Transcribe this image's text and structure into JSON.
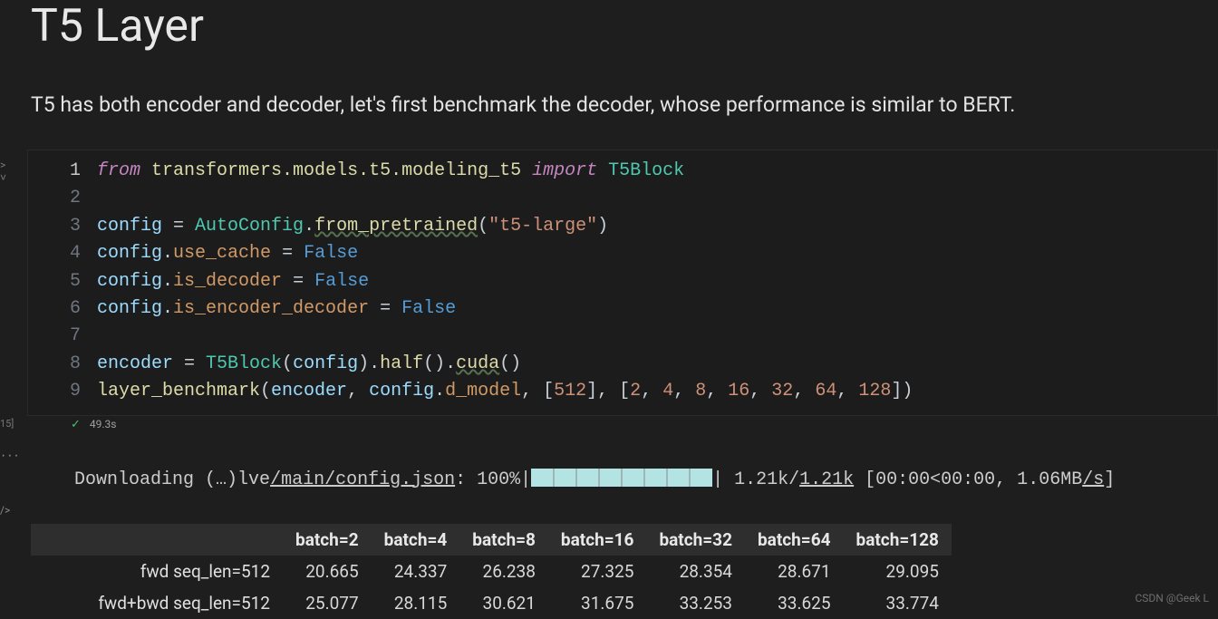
{
  "title": "T5 Layer",
  "lead": "T5 has both encoder and decoder, let's first benchmark the decoder, whose performance is similar to BERT.",
  "code_lines": [
    "1",
    "2",
    "3",
    "4",
    "5",
    "6",
    "7",
    "8",
    "9"
  ],
  "status": {
    "gutter_label": "15]",
    "check": "✓",
    "time": "49.3s"
  },
  "output": {
    "prefix": "Downloading (…)lve",
    "link1": "/main/config.json",
    "pct": ": 100%|",
    "right_a": "| 1.21k/",
    "link2": "1.21k",
    "right_b": " [00:00<00:00, 1.06MB",
    "link3": "/s",
    "right_c": "]"
  },
  "table": {
    "cols": [
      "batch=2",
      "batch=4",
      "batch=8",
      "batch=16",
      "batch=32",
      "batch=64",
      "batch=128"
    ],
    "rows": [
      {
        "label": "fwd seq_len=512",
        "vals": [
          "20.665",
          "24.337",
          "26.238",
          "27.325",
          "28.354",
          "28.671",
          "29.095"
        ]
      },
      {
        "label": "fwd+bwd seq_len=512",
        "vals": [
          "25.077",
          "28.115",
          "30.621",
          "31.675",
          "33.253",
          "33.625",
          "33.774"
        ]
      }
    ]
  },
  "chart_data": {
    "type": "table",
    "columns": [
      "",
      "batch=2",
      "batch=4",
      "batch=8",
      "batch=16",
      "batch=32",
      "batch=64",
      "batch=128"
    ],
    "rows": [
      [
        "fwd seq_len=512",
        20.665,
        24.337,
        26.238,
        27.325,
        28.354,
        28.671,
        29.095
      ],
      [
        "fwd+bwd seq_len=512",
        25.077,
        28.115,
        30.621,
        31.675,
        33.253,
        33.625,
        33.774
      ]
    ]
  },
  "watermark": "CSDN @Geek L",
  "gutter_top": {
    "a": ">",
    "b": "˅"
  },
  "gutter_dots": "···",
  "gutter_slash": "/>",
  "code": {
    "l1_from": "from",
    "l1_pkg": "transformers.models.t5.modeling_t5",
    "l1_import": "import",
    "l1_cls": "T5Block",
    "l3_cfg": "config",
    "l3_eq": " = ",
    "l3_auto": "AutoConfig",
    "l3_d": ".",
    "l3_fp": "from_pretrained",
    "l3_op": "(",
    "l3_str": "\"t5-large\"",
    "l3_cp": ")",
    "l4_cfg": "config",
    "l4_d": ".",
    "l4_prop": "use_cache",
    "l4_eq": " = ",
    "l4_val": "False",
    "l5_cfg": "config",
    "l5_d": ".",
    "l5_prop": "is_decoder",
    "l5_eq": " = ",
    "l5_val": "False",
    "l6_cfg": "config",
    "l6_d": ".",
    "l6_prop": "is_encoder_decoder",
    "l6_eq": " = ",
    "l6_val": "False",
    "l8_enc": "encoder",
    "l8_eq": " = ",
    "l8_cls": "T5Block",
    "l8_op": "(",
    "l8_cfg": "config",
    "l8_cp": ")",
    "l8_d1": ".",
    "l8_half": "half",
    "l8_hp": "()",
    "l8_d2": ".",
    "l8_cuda": "cuda",
    "l8_cp2": "()",
    "l9_fn": "layer_benchmark",
    "l9_op": "(",
    "l9_enc": "encoder",
    "l9_c1": ", ",
    "l9_cfg": "config",
    "l9_d": ".",
    "l9_prop": "d_model",
    "l9_c2": ", [",
    "l9_n512": "512",
    "l9_c3": "], [",
    "l9_n2": "2",
    "l9_cm1": ", ",
    "l9_n4": "4",
    "l9_cm2": ", ",
    "l9_n8": "8",
    "l9_cm3": ", ",
    "l9_n16": "16",
    "l9_cm4": ", ",
    "l9_n32": "32",
    "l9_cm5": ", ",
    "l9_n64": "64",
    "l9_cm6": ", ",
    "l9_n128": "128",
    "l9_end": "])"
  }
}
